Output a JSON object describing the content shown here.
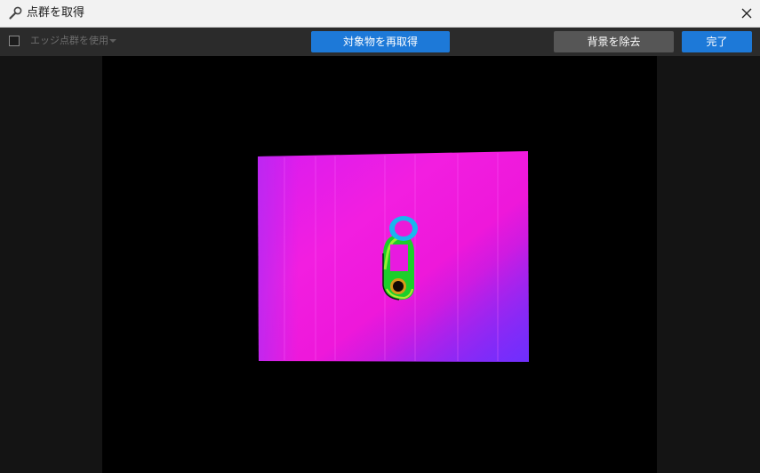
{
  "window": {
    "title": "点群を取得"
  },
  "toolbar": {
    "edge_checkbox_checked": false,
    "edge_label": "エッジ点群を使用",
    "recapture_label": "対象物を再取得",
    "remove_background_label": "背景を除去",
    "done_label": "完了"
  },
  "colors": {
    "primary_button": "#1d79d8",
    "secondary_button": "#565656",
    "toolbar_bg": "#2b2b2b",
    "viewport_bg": "#141414",
    "canvas_bg": "#000000"
  },
  "icons": {
    "title": "wrench-icon",
    "close": "close-icon",
    "dropdown": "chevron-down-icon"
  }
}
